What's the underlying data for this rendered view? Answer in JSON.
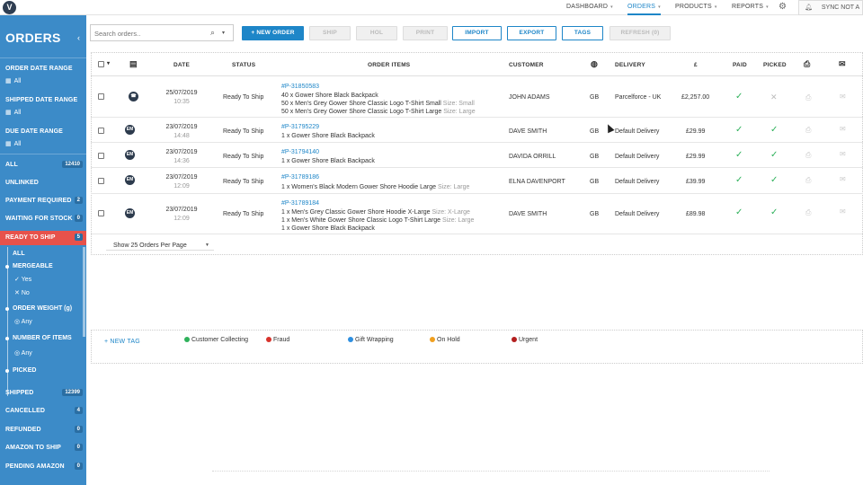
{
  "app": {
    "logo": "V"
  },
  "topnav": [
    {
      "label": "DASHBOARD",
      "caret": "▾"
    },
    {
      "label": "ORDERS",
      "caret": "▾"
    },
    {
      "label": "PRODUCTS",
      "caret": "▾"
    },
    {
      "label": "REPORTS",
      "caret": "▾"
    }
  ],
  "sync": {
    "label": "SYNC NOT A"
  },
  "sidebar": {
    "title": "ORDERS",
    "collapse": "‹",
    "filters": [
      {
        "label": "ORDER DATE RANGE",
        "value": "All"
      },
      {
        "label": "SHIPPED DATE RANGE",
        "value": "All"
      },
      {
        "label": "DUE DATE RANGE",
        "value": "All"
      }
    ],
    "statuses": [
      {
        "label": "ALL",
        "count": "12410"
      },
      {
        "label": "UNLINKED",
        "count": ""
      },
      {
        "label": "PAYMENT REQUIRED",
        "count": "2"
      },
      {
        "label": "WAITING FOR STOCK",
        "count": "0"
      },
      {
        "label": "READY TO SHIP",
        "count": "5"
      }
    ],
    "ready_sub": {
      "all": "ALL",
      "mergeable": "MERGEABLE",
      "yes": "Yes",
      "no": "No",
      "order_weight": "ORDER WEIGHT (g)",
      "weight_any": "Any",
      "num_items": "NUMBER OF ITEMS",
      "items_any": "Any",
      "picked": "PICKED"
    },
    "statuses2": [
      {
        "label": "SHIPPED",
        "count": "12399"
      },
      {
        "label": "CANCELLED",
        "count": "4"
      },
      {
        "label": "REFUNDED",
        "count": "0"
      },
      {
        "label": "AMAZON TO SHIP",
        "count": "0"
      },
      {
        "label": "PENDING AMAZON",
        "count": "0"
      }
    ]
  },
  "toolbar": {
    "search_placeholder": "Search orders..",
    "new_order": "+ NEW ORDER",
    "ship": "SHIP",
    "hol": "HOL",
    "print": "PRINT",
    "import": "IMPORT",
    "export": "EXPORT",
    "tags": "TAGS",
    "refresh": "REFRESH (0)"
  },
  "table": {
    "headers": {
      "date": "DATE",
      "status": "STATUS",
      "items": "ORDER ITEMS",
      "customer": "CUSTOMER",
      "delivery": "DELIVERY",
      "currency": "£",
      "paid": "PAID",
      "picked": "PICKED"
    },
    "rows": [
      {
        "channel": "phone-icon",
        "channel_label": "☎",
        "date": "25/07/2019",
        "time": "10:35",
        "status": "Ready To Ship",
        "order_id": "#P-31850583",
        "items": [
          {
            "text": "40 x Gower Shore Black Backpack",
            "size": ""
          },
          {
            "text": "50 x Men's Grey Gower Shore Classic Logo T-Shirt Small",
            "size": "Size: Small"
          },
          {
            "text": "50 x Men's Grey Gower Shore Classic Logo T-Shirt Large",
            "size": "Size: Large"
          }
        ],
        "customer": "JOHN ADAMS",
        "country": "GB",
        "delivery": "Parcelforce - UK",
        "total": "£2,257.00",
        "paid": true,
        "picked": false
      },
      {
        "channel": "em-icon",
        "channel_label": "EM",
        "date": "23/07/2019",
        "time": "14:48",
        "status": "Ready To Ship",
        "order_id": "#P-31795229",
        "items": [
          {
            "text": "1 x Gower Shore Black Backpack",
            "size": ""
          }
        ],
        "customer": "DAVE SMITH",
        "country": "GB",
        "delivery": "Default Delivery",
        "total": "£29.99",
        "paid": true,
        "picked": true
      },
      {
        "channel": "em-icon",
        "channel_label": "EM",
        "date": "23/07/2019",
        "time": "14:36",
        "status": "Ready To Ship",
        "order_id": "#P-31794140",
        "items": [
          {
            "text": "1 x Gower Shore Black Backpack",
            "size": ""
          }
        ],
        "customer": "DAVIDA ORRILL",
        "country": "GB",
        "delivery": "Default Delivery",
        "total": "£29.99",
        "paid": true,
        "picked": true
      },
      {
        "channel": "em-icon",
        "channel_label": "EM",
        "date": "23/07/2019",
        "time": "12:09",
        "status": "Ready To Ship",
        "order_id": "#P-31789186",
        "items": [
          {
            "text": "1 x Women's Black Modern Gower Shore Hoodie Large",
            "size": "Size: Large"
          }
        ],
        "customer": "ELNA DAVENPORT",
        "country": "GB",
        "delivery": "Default Delivery",
        "total": "£39.99",
        "paid": true,
        "picked": true
      },
      {
        "channel": "em-icon",
        "channel_label": "EM",
        "date": "23/07/2019",
        "time": "12:09",
        "status": "Ready To Ship",
        "order_id": "#P-31789184",
        "items": [
          {
            "text": "1 x Men's Grey Classic Gower Shore Hoodie X-Large",
            "size": "Size: X-Large"
          },
          {
            "text": "1 x Men's White Gower Shore Classic Logo T-Shirt Large",
            "size": "Size: Large"
          },
          {
            "text": "1 x Gower Shore Black Backpack",
            "size": ""
          }
        ],
        "customer": "DAVE SMITH",
        "country": "GB",
        "delivery": "Default Delivery",
        "total": "£89.98",
        "paid": true,
        "picked": true
      }
    ],
    "pager": "Show 25 Orders Per Page"
  },
  "tags": {
    "new_tag": "+ NEW TAG",
    "items": [
      {
        "label": "Customer Collecting",
        "color": "#2fb15b"
      },
      {
        "label": "Fraud",
        "color": "#d8332c"
      },
      {
        "label": "Gift Wrapping",
        "color": "#2e8fe0"
      },
      {
        "label": "On Hold",
        "color": "#f0a020"
      },
      {
        "label": "Urgent",
        "color": "#b31f1f"
      }
    ]
  },
  "colors": {
    "sidebar": "#3c8bc8",
    "accent": "#1e86c8",
    "active": "#e7524b",
    "paid_check": "#2fb15b"
  }
}
